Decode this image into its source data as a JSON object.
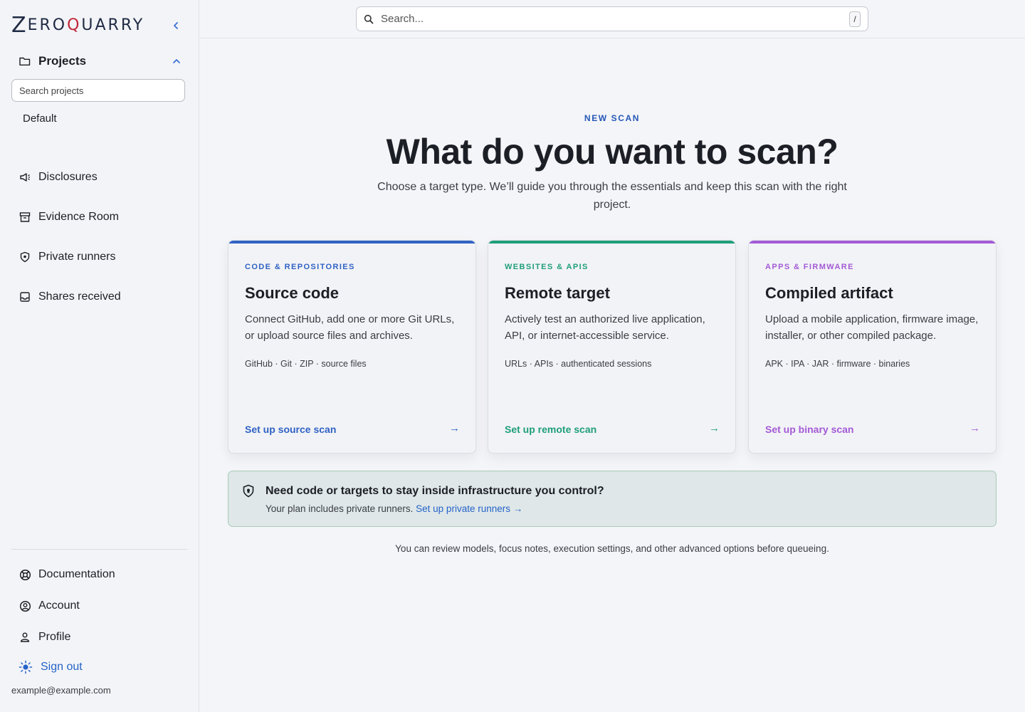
{
  "sidebar": {
    "logo_letters": [
      "Z",
      "ERO",
      "Q",
      "UARRY"
    ],
    "collapse_icon": "chevron-left-icon",
    "projects": {
      "label": "Projects",
      "search_placeholder": "Search projects",
      "items": [
        "Default"
      ]
    },
    "nav": [
      {
        "label": "Disclosures",
        "icon": "megaphone-icon"
      },
      {
        "label": "Evidence Room",
        "icon": "archive-icon"
      },
      {
        "label": "Private runners",
        "icon": "shield-icon"
      },
      {
        "label": "Shares received",
        "icon": "inbox-icon"
      }
    ],
    "footer_nav": [
      {
        "label": "Documentation",
        "icon": "lifebuoy-icon"
      },
      {
        "label": "Account",
        "icon": "user-circle-icon"
      },
      {
        "label": "Profile",
        "icon": "user-icon"
      },
      {
        "label": "Sign out",
        "icon": "sun-icon"
      }
    ],
    "email": "example@example.com"
  },
  "topbar": {
    "search_placeholder": "Search...",
    "shortcut": "/"
  },
  "main": {
    "eyebrow": "NEW SCAN",
    "headline": "What do you want to scan?",
    "subhead": "Choose a target type. We’ll guide you through the essentials and keep this scan with the right project.",
    "cards": [
      {
        "category": "CODE & REPOSITORIES",
        "title": "Source code",
        "description": "Connect GitHub, add one or more Git URLs, or upload source files and archives.",
        "tags": "GitHub · Git · ZIP · source files",
        "cta": "Set up source scan",
        "arrow": "→",
        "accent": "#2f62c4"
      },
      {
        "category": "WEBSITES & APIS",
        "title": "Remote target",
        "description": "Actively test an authorized live application, API, or internet-accessible service.",
        "tags": "URLs · APIs · authenticated sessions",
        "cta": "Set up remote scan",
        "arrow": "→",
        "accent": "#1e9e7a"
      },
      {
        "category": "APPS & FIRMWARE",
        "title": "Compiled artifact",
        "description": "Upload a mobile application, firmware image, installer, or other compiled package.",
        "tags": "APK · IPA · JAR · firmware · binaries",
        "cta": "Set up binary scan",
        "arrow": "→",
        "accent": "#a35ad6"
      }
    ],
    "notice": {
      "title": "Need code or targets to stay inside infrastructure you control?",
      "body": "Your plan includes private runners.",
      "link": "Set up private runners →"
    },
    "footnote": "You can review models, focus notes, execution settings, and other advanced options before queueing."
  }
}
